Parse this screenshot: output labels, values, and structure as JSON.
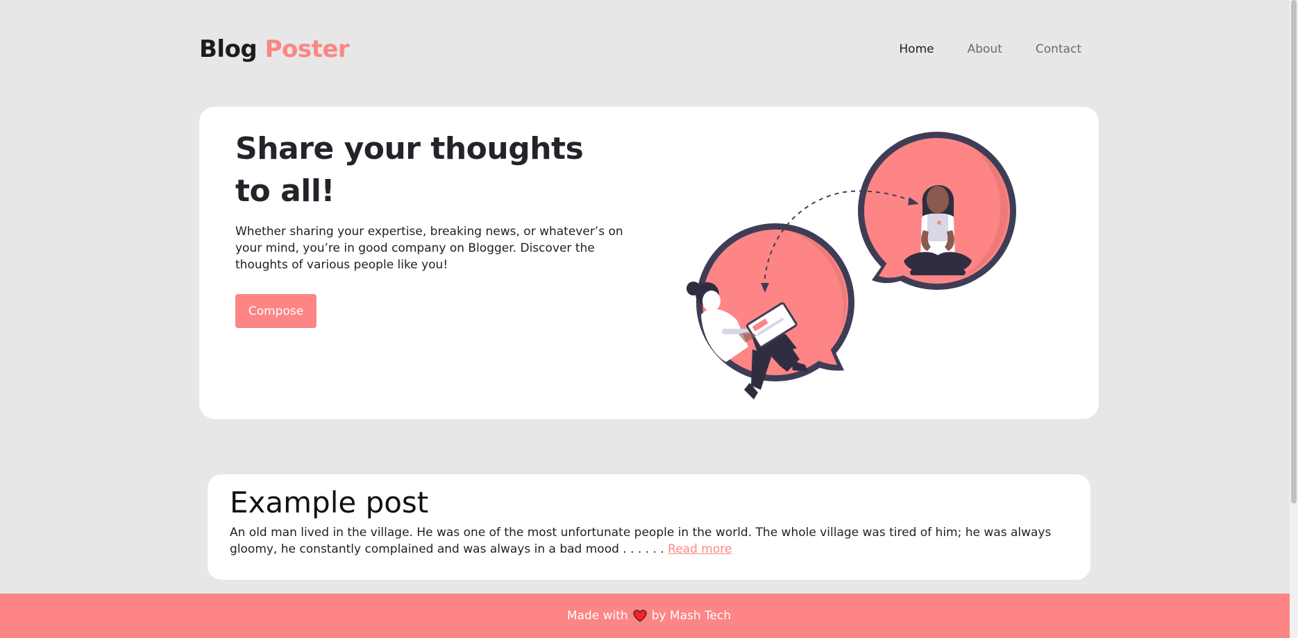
{
  "brand": {
    "part1": "Blog",
    "part2": "Poster"
  },
  "nav": [
    {
      "label": "Home",
      "active": true
    },
    {
      "label": "About",
      "active": false
    },
    {
      "label": "Contact",
      "active": false
    }
  ],
  "hero": {
    "title_line1": "Share your thoughts",
    "title_line2": "to all!",
    "text": "Whether sharing your expertise, breaking news, or whatever’s on your mind, you’re in good company on Blogger. Discover the thoughts of various people like you!",
    "compose_label": "Compose"
  },
  "post": {
    "title": "Example post",
    "excerpt": "An old man lived in the village. He was one of the most unfortunate people in the world. The whole village was tired of him; he was always gloomy, he constantly complained and was always in a bad mood . . . . . .",
    "read_more": "Read more"
  },
  "footer": {
    "made_with": "Made with",
    "by": "by Mash Tech",
    "icon": "heart-icon"
  },
  "colors": {
    "accent": "#fd8585",
    "background": "#e7e7e7",
    "card": "#ffffff",
    "dark": "#3f3d56"
  }
}
